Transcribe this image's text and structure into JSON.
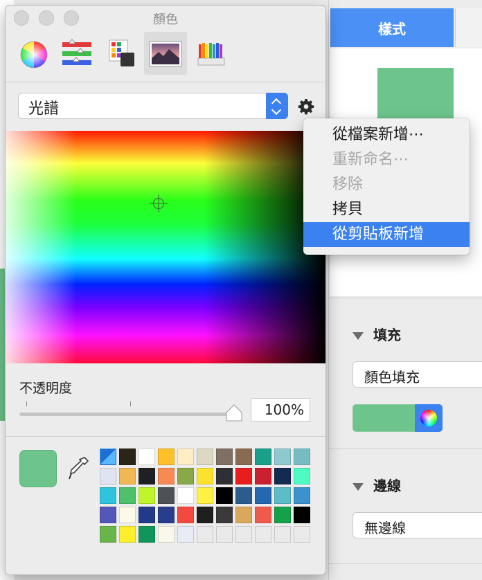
{
  "panel": {
    "title": "顏色",
    "modes": [
      {
        "name": "color-wheel"
      },
      {
        "name": "sliders"
      },
      {
        "name": "palettes"
      },
      {
        "name": "image-palettes",
        "active": true
      },
      {
        "name": "pencils"
      }
    ],
    "picker_select": {
      "value": "光譜"
    },
    "opacity": {
      "label": "不透明度",
      "value": "100%",
      "level": 1.0
    },
    "current_color": "#6dc58c"
  },
  "context_menu": {
    "items": [
      {
        "label": "從檔案新增⋯",
        "enabled": true
      },
      {
        "label": "重新命名⋯",
        "enabled": false
      },
      {
        "label": "移除",
        "enabled": false
      },
      {
        "label": "拷貝",
        "enabled": true
      },
      {
        "label": "從剪貼板新增",
        "enabled": true,
        "highlighted": true
      }
    ]
  },
  "swatches": [
    [
      "diag",
      "#2b2418",
      "#ffffff",
      "#fdc02a",
      "#fdeec6",
      "#ddd8c2",
      "#7e7062",
      "#8a6a50",
      "#18a08a",
      "#8ec9cf",
      "#76bcc3"
    ],
    [
      "#dfe4f0",
      "#f0b854",
      "#1f2024",
      "#f68a52",
      "#88a84a",
      "#fde22d",
      "#2f3035",
      "#e81d1d",
      "#cc2030",
      "#132b50",
      "#4dfbc3"
    ],
    [
      "#2fc4de",
      "#4ec16a",
      "#c0f52a",
      "#4d5258",
      "#ffffff",
      "#fff142",
      "#000000",
      "#2a5c8e",
      "#2468b2",
      "#5bbdc8",
      "#3c92cc"
    ],
    [
      "#5456b8",
      "#fcf9e8",
      "#233a8a",
      "#283d8c",
      "#f24a3e",
      "#1f1f1f",
      "#3a3a3a",
      "#dba75a",
      "#f05a4a",
      "#13a24a",
      "#000000"
    ],
    [
      "#6ab54a",
      "#fdef2a",
      "#12955a",
      "#faf8ea",
      "#e8ecf4",
      "#eaeaea",
      "#eaeaea",
      "#eaeaea",
      "#eaeaea",
      "#eaeaea",
      "#eaeaea"
    ]
  ],
  "inspector": {
    "active_tab": "樣式",
    "fill": {
      "section_title": "填充",
      "type": "顏色填充",
      "color": "#6dc58c"
    },
    "border": {
      "section_title": "邊線",
      "type": "無邊線"
    }
  }
}
